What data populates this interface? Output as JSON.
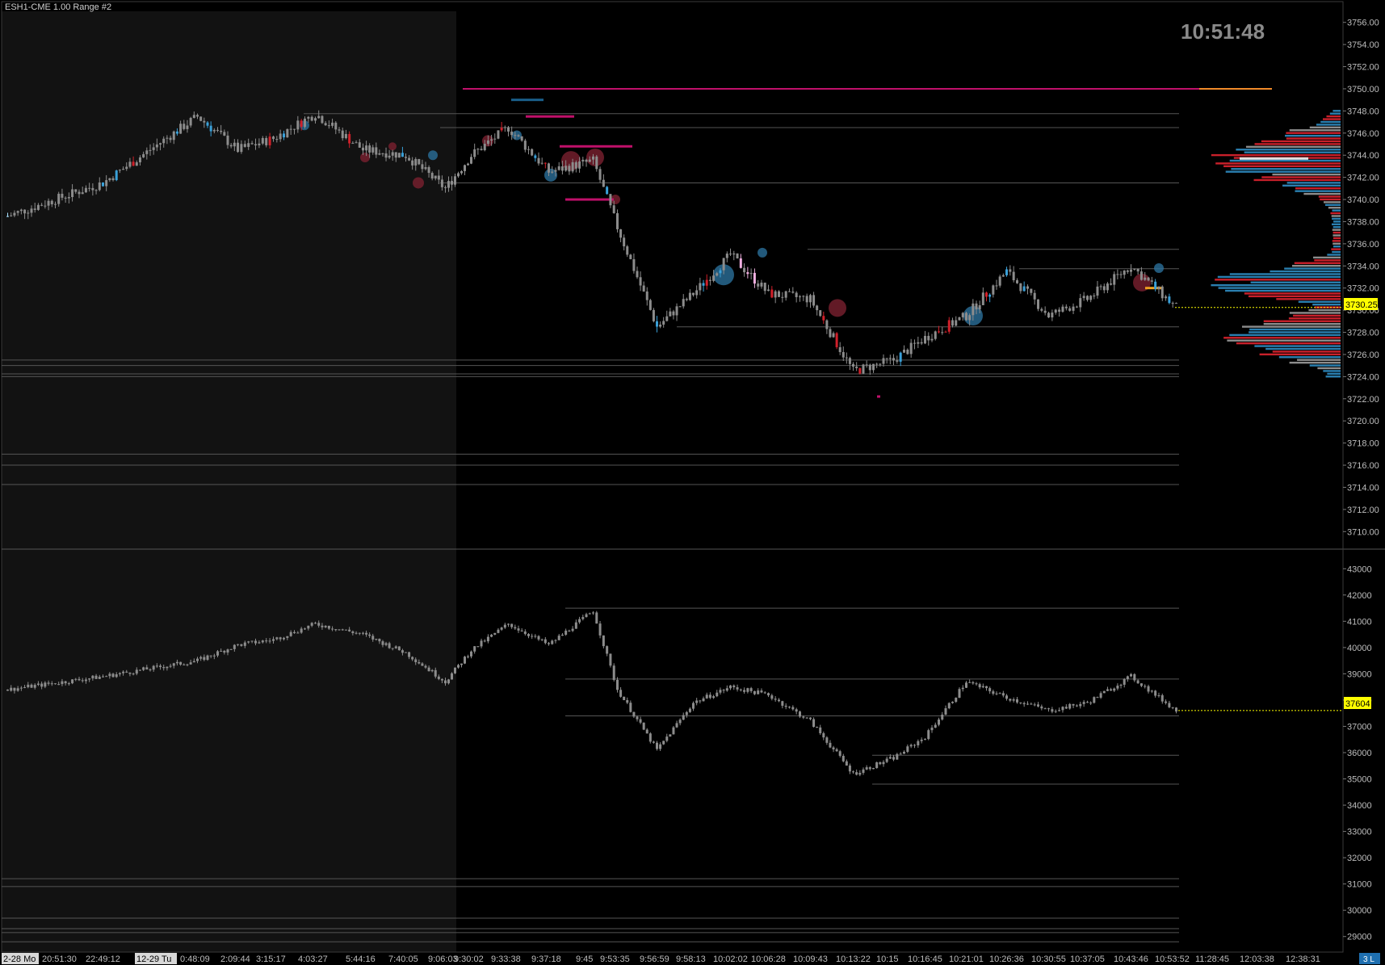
{
  "chart_title": "ESH1-CME  1.00 Range  #2",
  "clock": "10:51:48",
  "colors": {
    "background": "#000000",
    "session_shade": "#121212",
    "bar_neutral": "#8c8c8c",
    "bar_blue": "#3aa0d8",
    "bar_red": "#d0202a",
    "bar_pink": "#f0b0e0",
    "price_tag": "#ffff00",
    "level_line": "#555555",
    "magenta_level": "#c0106a",
    "orange_level": "#f08a2a"
  },
  "price_pane": {
    "axis_labels": [
      "3756.00",
      "3754.00",
      "3752.00",
      "3750.00",
      "3748.00",
      "3746.00",
      "3744.00",
      "3742.00",
      "3740.00",
      "3738.00",
      "3736.00",
      "3734.00",
      "3732.00",
      "3730.00",
      "3728.00",
      "3726.00",
      "3724.00",
      "3722.00",
      "3720.00",
      "3718.00",
      "3716.00",
      "3714.00",
      "3712.00",
      "3710.00"
    ],
    "last_price": "3730.25"
  },
  "cumulative_pane": {
    "axis_labels": [
      "43000",
      "42000",
      "41000",
      "40000",
      "39000",
      "38000",
      "37000",
      "36000",
      "35000",
      "34000",
      "33000",
      "32000",
      "31000",
      "30000",
      "29000"
    ],
    "last_value": "37604"
  },
  "time_axis": {
    "labels": [
      "2-28 Mo",
      "20:51:30",
      "22:49:12",
      "12-29 Tu",
      "0:48:09",
      "2:09:44",
      "3:15:17",
      "4:03:27",
      "5:44:16",
      "7:40:05",
      "9:06:03",
      "9:30:02",
      "9:33:38",
      "9:37:18",
      "9:45",
      "9:53:35",
      "9:56:59",
      "9:58:13",
      "10:02:02",
      "10:06:28",
      "10:09:43",
      "10:13:22",
      "10:15",
      "10:16:45",
      "10:21:01",
      "10:26:36",
      "10:30:55",
      "10:37:05",
      "10:43:46",
      "10:53:52",
      "11:28:45",
      "12:03:38",
      "12:38:31"
    ],
    "corner_label": "3 L"
  },
  "chart_data": [
    {
      "type": "candlestick",
      "title": "ESH1-CME  1.00 Range  #2",
      "ylim": [
        3709,
        3757
      ],
      "y_unit": "price",
      "anchors": [
        {
          "t": "20:51:30",
          "close": 3738.5
        },
        {
          "t": "22:49:12",
          "close": 3741.5
        },
        {
          "t": "0:48:09",
          "close": 3747.5
        },
        {
          "t": "2:09:44",
          "close": 3744.5
        },
        {
          "t": "3:15:17",
          "close": 3745.5
        },
        {
          "t": "4:03:27",
          "close": 3747.75
        },
        {
          "t": "5:44:16",
          "close": 3744.5
        },
        {
          "t": "7:40:05",
          "close": 3744.0
        },
        {
          "t": "9:06:03",
          "close": 3741.0
        },
        {
          "t": "9:30:02",
          "close": 3744.0
        },
        {
          "t": "9:33:38",
          "close": 3746.5
        },
        {
          "t": "9:37:18",
          "close": 3742.5
        },
        {
          "t": "9:45",
          "close": 3743.5
        },
        {
          "t": "9:53:35",
          "close": 3737.5
        },
        {
          "t": "9:56:59",
          "close": 3728.5
        },
        {
          "t": "9:58:13",
          "close": 3731.5
        },
        {
          "t": "10:02:02",
          "close": 3735.0
        },
        {
          "t": "10:06:28",
          "close": 3731.5
        },
        {
          "t": "10:09:43",
          "close": 3731.0
        },
        {
          "t": "10:13:22",
          "close": 3724.5
        },
        {
          "t": "10:15",
          "close": 3725.5
        },
        {
          "t": "10:16:45",
          "close": 3727.5
        },
        {
          "t": "10:21:01",
          "close": 3729.5
        },
        {
          "t": "10:26:36",
          "close": 3733.5
        },
        {
          "t": "10:30:55",
          "close": 3729.5
        },
        {
          "t": "10:37:05",
          "close": 3731.0
        },
        {
          "t": "10:43:46",
          "close": 3734.0
        },
        {
          "t": "10:53:52",
          "close": 3730.25
        }
      ],
      "levels": [
        3750.0,
        3747.75,
        3746.5,
        3741.5,
        3735.5,
        3733.75,
        3728.5,
        3725.5,
        3725.0,
        3724.25,
        3724.0,
        3717.0,
        3716.0,
        3714.25
      ]
    },
    {
      "type": "candlestick",
      "title": "",
      "ylim": [
        28500,
        43500
      ],
      "y_unit": "cumulative delta",
      "anchors": [
        {
          "t": "20:51:30",
          "close": 38400
        },
        {
          "t": "22:49:12",
          "close": 38900
        },
        {
          "t": "0:48:09",
          "close": 39500
        },
        {
          "t": "2:09:44",
          "close": 40100
        },
        {
          "t": "3:15:17",
          "close": 40300
        },
        {
          "t": "4:03:27",
          "close": 40900
        },
        {
          "t": "5:44:16",
          "close": 40500
        },
        {
          "t": "7:40:05",
          "close": 39800
        },
        {
          "t": "9:06:03",
          "close": 38700
        },
        {
          "t": "9:30:02",
          "close": 39900
        },
        {
          "t": "9:33:38",
          "close": 40900
        },
        {
          "t": "9:37:18",
          "close": 40100
        },
        {
          "t": "9:45",
          "close": 41400
        },
        {
          "t": "9:53:35",
          "close": 38400
        },
        {
          "t": "9:56:59",
          "close": 36100
        },
        {
          "t": "9:58:13",
          "close": 37900
        },
        {
          "t": "10:02:02",
          "close": 38500
        },
        {
          "t": "10:06:28",
          "close": 38200
        },
        {
          "t": "10:09:43",
          "close": 37200
        },
        {
          "t": "10:13:22",
          "close": 35200
        },
        {
          "t": "10:15",
          "close": 35800
        },
        {
          "t": "10:16:45",
          "close": 36600
        },
        {
          "t": "10:21:01",
          "close": 38700
        },
        {
          "t": "10:26:36",
          "close": 38100
        },
        {
          "t": "10:30:55",
          "close": 37600
        },
        {
          "t": "10:37:05",
          "close": 37900
        },
        {
          "t": "10:43:46",
          "close": 38900
        },
        {
          "t": "10:53:52",
          "close": 37604
        }
      ],
      "levels": [
        41500,
        38800,
        37400,
        35900,
        34800,
        31200,
        30900,
        29700,
        29300,
        29150,
        28800
      ]
    }
  ]
}
